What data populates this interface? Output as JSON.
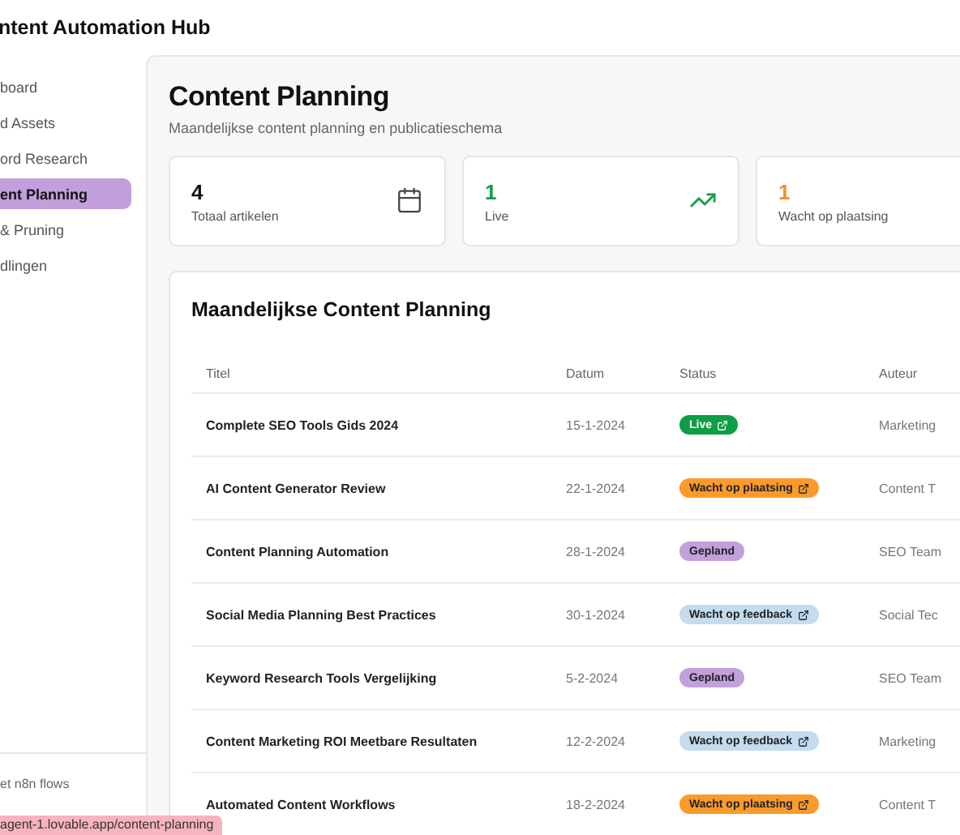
{
  "app_title": "ntent Automation Hub",
  "sidebar": {
    "items": [
      {
        "label": "board",
        "selected": false
      },
      {
        "label": "d Assets",
        "selected": false
      },
      {
        "label": "ord Research",
        "selected": false
      },
      {
        "label": "ent Planning",
        "selected": true
      },
      {
        "label": "& Pruning",
        "selected": false
      },
      {
        "label": "dlingen",
        "selected": false
      }
    ],
    "footer": "et n8n flows"
  },
  "page": {
    "title": "Content Planning",
    "subtitle": "Maandelijkse content planning en publicatieschema"
  },
  "stats": [
    {
      "value": "4",
      "label": "Totaal artikelen",
      "kind": "total"
    },
    {
      "value": "1",
      "label": "Live",
      "kind": "live"
    },
    {
      "value": "1",
      "label": "Wacht op plaatsing",
      "kind": "pending"
    }
  ],
  "table": {
    "title": "Maandelijkse Content Planning",
    "columns": [
      "Titel",
      "Datum",
      "Status",
      "Auteur"
    ],
    "rows": [
      {
        "title": "Complete SEO Tools Gids 2024",
        "date": "15-1-2024",
        "status": "Live",
        "kind": "live",
        "link": true,
        "author": "Marketing"
      },
      {
        "title": "AI Content Generator Review",
        "date": "22-1-2024",
        "status": "Wacht op plaatsing",
        "kind": "placement",
        "link": true,
        "author": "Content T"
      },
      {
        "title": "Content Planning Automation",
        "date": "28-1-2024",
        "status": "Gepland",
        "kind": "planned",
        "link": false,
        "author": "SEO Team"
      },
      {
        "title": "Social Media Planning Best Practices",
        "date": "30-1-2024",
        "status": "Wacht op feedback",
        "kind": "feedback",
        "link": true,
        "author": "Social Tec"
      },
      {
        "title": "Keyword Research Tools Vergelijking",
        "date": "5-2-2024",
        "status": "Gepland",
        "kind": "planned",
        "link": false,
        "author": "SEO Team"
      },
      {
        "title": "Content Marketing ROI Meetbare Resultaten",
        "date": "12-2-2024",
        "status": "Wacht op feedback",
        "kind": "feedback",
        "link": true,
        "author": "Marketing"
      },
      {
        "title": "Automated Content Workflows",
        "date": "18-2-2024",
        "status": "Wacht op plaatsing",
        "kind": "placement",
        "link": true,
        "author": "Content T"
      }
    ]
  },
  "status_bar": {
    "url": "agent-1.lovable.app/content-planning"
  }
}
